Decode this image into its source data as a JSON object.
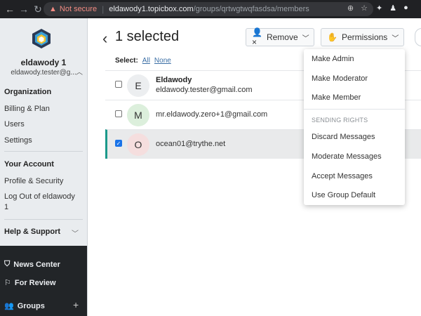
{
  "browser": {
    "not_secure": "Not secure",
    "host": "eldawody1.topicbox.com",
    "path": "/groups/qrtwgtwqfasdsa/members"
  },
  "sidebar": {
    "account_name": "eldawody 1",
    "account_email": "eldawody.tester@g...",
    "org_heading": "Organization",
    "org_items": [
      "Billing & Plan",
      "Users",
      "Settings"
    ],
    "account_heading": "Your Account",
    "account_items": [
      "Profile & Security",
      "Log Out of eldawody 1"
    ],
    "help_heading": "Help & Support",
    "news_center": "News Center",
    "for_review": "For Review",
    "groups": "Groups"
  },
  "main": {
    "title": "1 selected",
    "remove_label": "Remove",
    "permissions_label": "Permissions",
    "select_label": "Select:",
    "select_all": "All",
    "select_none": "None",
    "members": [
      {
        "initial": "E",
        "name": "Eldawody",
        "email": "eldawody.tester@gmail.com",
        "checked": false
      },
      {
        "initial": "M",
        "name": "",
        "email": "mr.eldawody.zero+1@gmail.com",
        "checked": false
      },
      {
        "initial": "O",
        "name": "",
        "email": "ocean01@trythe.net",
        "checked": true
      }
    ]
  },
  "permissions_menu": {
    "items": [
      "Make Admin",
      "Make Moderator",
      "Make Member"
    ],
    "sending_heading": "SENDING RIGHTS",
    "sending_items": [
      "Discard Messages",
      "Moderate Messages",
      "Accept Messages",
      "Use Group Default"
    ]
  },
  "colors": {
    "accent_teal": "#1b998b",
    "checkbox_blue": "#1a73e8",
    "warning_red": "#f28b82"
  }
}
